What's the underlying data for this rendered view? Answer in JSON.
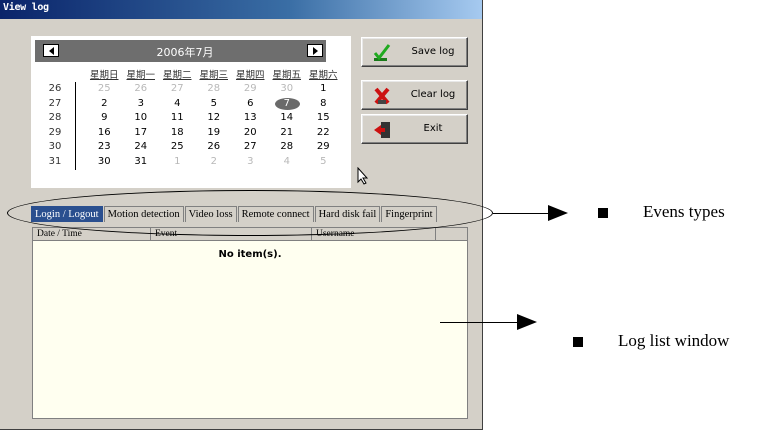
{
  "window": {
    "title": "View log"
  },
  "calendar": {
    "month_label": "2006年7月",
    "weekdays": [
      "星期日",
      "星期一",
      "星期二",
      "星期三",
      "星期四",
      "星期五",
      "星期六"
    ],
    "week_numbers": [
      "26",
      "27",
      "28",
      "29",
      "30",
      "31"
    ],
    "weeks": [
      [
        {
          "d": "25",
          "muted": true
        },
        {
          "d": "26",
          "muted": true
        },
        {
          "d": "27",
          "muted": true
        },
        {
          "d": "28",
          "muted": true
        },
        {
          "d": "29",
          "muted": true
        },
        {
          "d": "30",
          "muted": true
        },
        {
          "d": "1"
        }
      ],
      [
        {
          "d": "2"
        },
        {
          "d": "3"
        },
        {
          "d": "4"
        },
        {
          "d": "5"
        },
        {
          "d": "6"
        },
        {
          "d": "7",
          "today": true
        },
        {
          "d": "8"
        }
      ],
      [
        {
          "d": "9"
        },
        {
          "d": "10"
        },
        {
          "d": "11"
        },
        {
          "d": "12"
        },
        {
          "d": "13"
        },
        {
          "d": "14"
        },
        {
          "d": "15"
        }
      ],
      [
        {
          "d": "16"
        },
        {
          "d": "17"
        },
        {
          "d": "18"
        },
        {
          "d": "19"
        },
        {
          "d": "20"
        },
        {
          "d": "21"
        },
        {
          "d": "22"
        }
      ],
      [
        {
          "d": "23"
        },
        {
          "d": "24"
        },
        {
          "d": "25"
        },
        {
          "d": "26"
        },
        {
          "d": "27"
        },
        {
          "d": "28"
        },
        {
          "d": "29"
        }
      ],
      [
        {
          "d": "30"
        },
        {
          "d": "31"
        },
        {
          "d": "1",
          "muted": true
        },
        {
          "d": "2",
          "muted": true
        },
        {
          "d": "3",
          "muted": true
        },
        {
          "d": "4",
          "muted": true
        },
        {
          "d": "5",
          "muted": true
        }
      ]
    ]
  },
  "buttons": {
    "save": {
      "label": "Save log",
      "icon": "checkmark-icon"
    },
    "clear": {
      "label": "Clear log",
      "icon": "red-x-icon"
    },
    "exit": {
      "label": "Exit",
      "icon": "exit-door-icon"
    }
  },
  "tabs": [
    {
      "label": "Login / Logout",
      "active": true
    },
    {
      "label": "Motion detection"
    },
    {
      "label": "Video loss"
    },
    {
      "label": "Remote connect"
    },
    {
      "label": "Hard disk fail"
    },
    {
      "label": "Fingerprint"
    }
  ],
  "log_list": {
    "columns": [
      "Date / Time",
      "Event",
      "Username",
      ""
    ],
    "empty_text": "No item(s)."
  },
  "annotations": {
    "events_types": "Evens types",
    "log_list_window": "Log list window"
  },
  "colors": {
    "title_start": "#0a246a",
    "title_end": "#a6caf0",
    "active_tab": "#2a4f8f",
    "list_bg": "#fffff0"
  }
}
